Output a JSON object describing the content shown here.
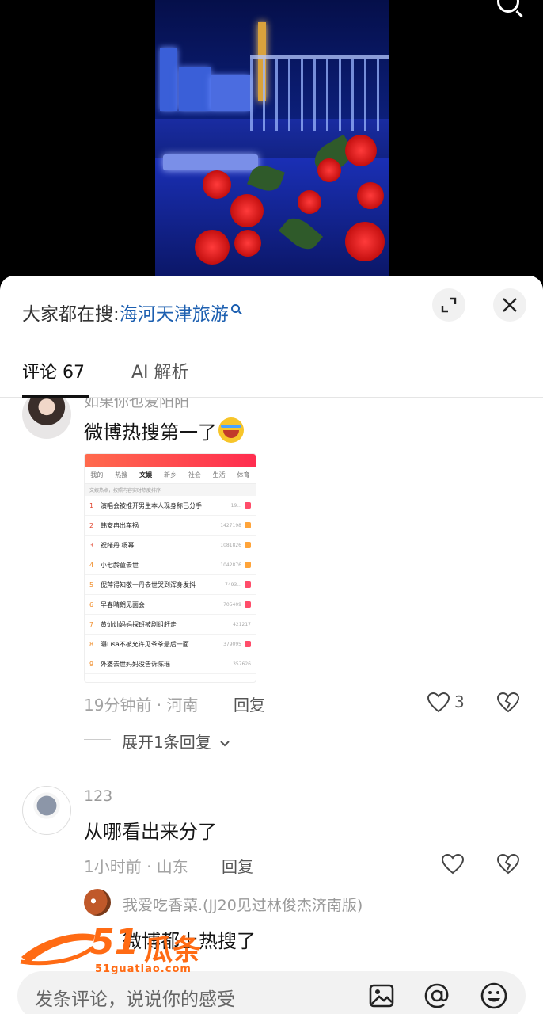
{
  "hot_search": {
    "prefix": "大家都在搜:",
    "term": "海河天津旅游"
  },
  "tabs": [
    {
      "label": "评论 67",
      "active": true
    },
    {
      "label": "AI 解析",
      "active": false
    }
  ],
  "comments": [
    {
      "username": "如果你也爱阳阳",
      "text": "微博热搜第一了",
      "emoji": "crying-laughing-emoji",
      "image": {
        "tabs": [
          "我的",
          "热搜",
          "文娱",
          "新乡",
          "社会",
          "生活",
          "体育"
        ],
        "active_tab": "文娱",
        "subtitle": "文娱热点，按照内容实时热度排序",
        "rows": [
          {
            "rank": "1",
            "title": "演唱会被推开男生本人现身称已分手",
            "count": "19..."
          },
          {
            "rank": "2",
            "title": "韩安冉出车祸",
            "count": "1427198"
          },
          {
            "rank": "3",
            "title": "祝绪丹 杨幂",
            "count": "1081826"
          },
          {
            "rank": "4",
            "title": "小七龄童去世",
            "count": "1042876"
          },
          {
            "rank": "5",
            "title": "倪萍得知敬一丹去世哭到浑身发抖",
            "count": "7493..."
          },
          {
            "rank": "6",
            "title": "早春晴朗见面会",
            "count": "705409"
          },
          {
            "rank": "7",
            "title": "黄灿灿妈妈探班被剧组赶走",
            "count": "421217"
          },
          {
            "rank": "8",
            "title": "曝Lisa不被允许见爷爷最后一面",
            "count": "379095"
          },
          {
            "rank": "9",
            "title": "外婆去世妈妈没告诉陈瑶",
            "count": "357626"
          }
        ]
      },
      "time_location": "19分钟前 · 河南",
      "reply_label": "回复",
      "likes": "3",
      "expand_label": "展开1条回复"
    },
    {
      "username": "123",
      "text": "从哪看出来分了",
      "time_location": "1小时前 · 山东",
      "reply_label": "回复",
      "likes": "",
      "sub_reply": {
        "username": "我爱吃香菜.(JJ20见过林俊杰济南版)",
        "text": "微博都上热搜了"
      }
    }
  ],
  "input": {
    "placeholder": "发条评论，说说你的感受"
  },
  "watermark": {
    "number": "51",
    "text": "瓜条",
    "url": "51guatiao.com"
  },
  "colors": {
    "link_blue": "#1c5fb0",
    "watermark_orange": "#ff6b14"
  }
}
